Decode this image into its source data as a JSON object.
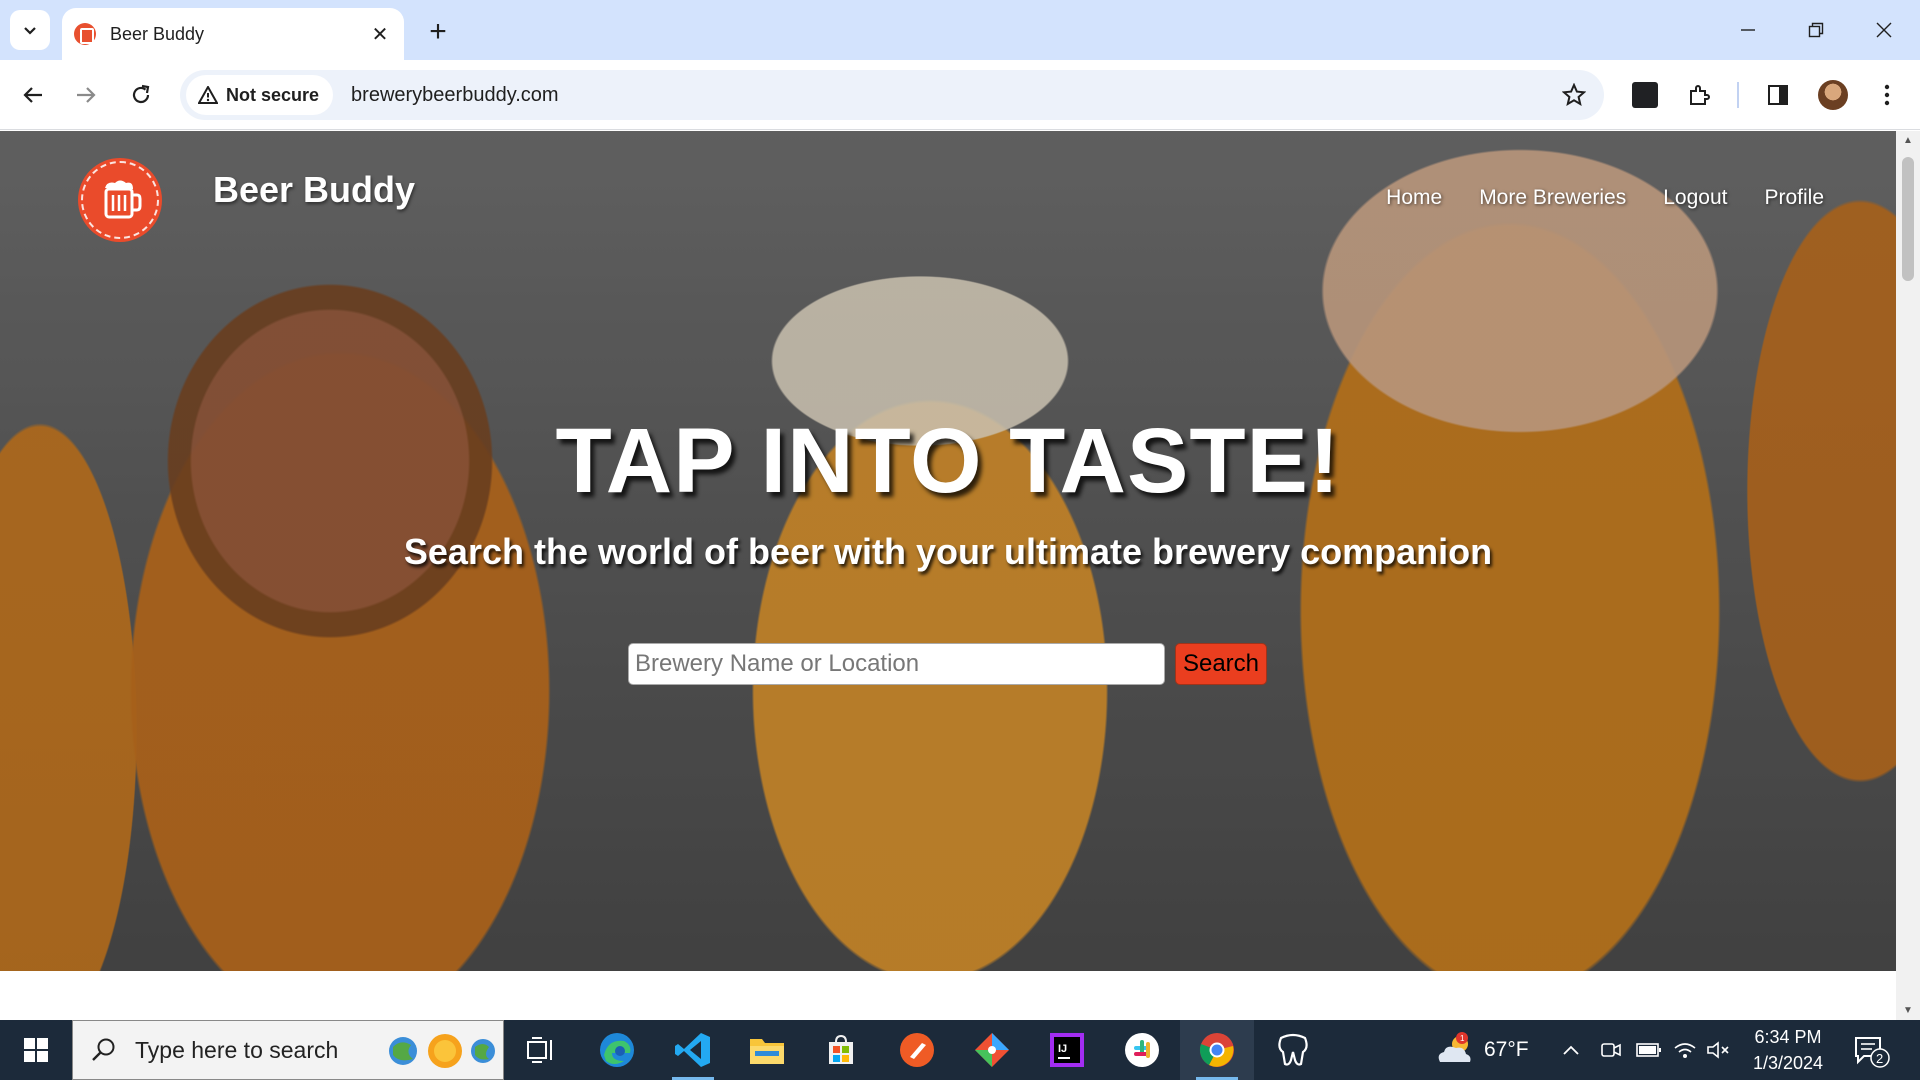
{
  "browser": {
    "tab_title": "Beer Buddy",
    "tab_close": "✕",
    "new_tab": "+",
    "security_label": "Not secure",
    "url": "brewerybeerbuddy.com"
  },
  "site": {
    "title": "Beer Buddy",
    "nav": [
      "Home",
      "More Breweries",
      "Logout",
      "Profile"
    ],
    "headline": "TAP INTO TASTE!",
    "subheadline": "Search the world of beer with your ultimate brewery companion",
    "search_placeholder": "Brewery Name or Location",
    "search_button": "Search"
  },
  "taskbar": {
    "search_placeholder": "Type here to search",
    "weather_temp": "67°F",
    "weather_badge": "1",
    "time": "6:34 PM",
    "date": "1/3/2024",
    "notification_count": "2"
  },
  "colors": {
    "brand": "#ea4b2b",
    "search_button_bg": "#ea3e1f",
    "tabbar_bg": "#d3e3fd",
    "taskbar_bg": "#1c2a3a"
  }
}
